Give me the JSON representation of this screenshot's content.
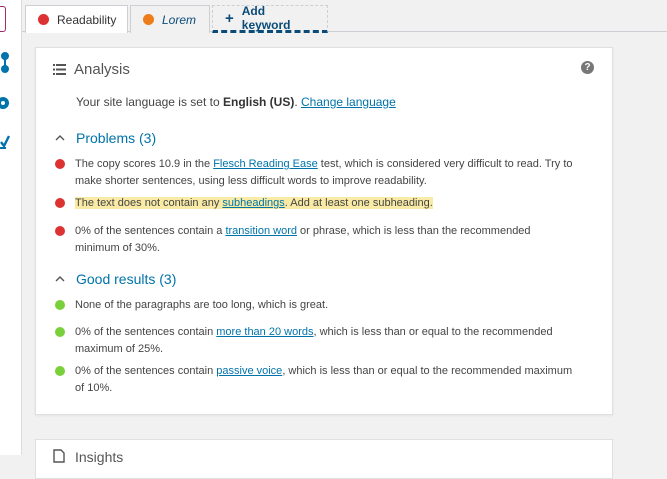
{
  "colors": {
    "bad": "#dc3232",
    "good": "#7ad03a",
    "ok": "#ee7c1b",
    "link": "#0073aa",
    "highlight": "#f9eba5"
  },
  "tabs": [
    {
      "label": "Readability",
      "status": "bad"
    },
    {
      "label": "Lorem",
      "status": "ok"
    },
    {
      "label": "Add keyword",
      "icon": "plus-icon"
    }
  ],
  "analysis": {
    "title": "Analysis",
    "language_prefix": "Your site language is set to ",
    "language": "English (US)",
    "language_suffix": ". ",
    "change_language": "Change language",
    "problems_title": "Problems (3)",
    "problems": [
      {
        "pre": "The copy scores 10.9 in the ",
        "link": "Flesch Reading Ease",
        "post": " test, which is considered very difficult to read. Try to make shorter sentences, using less difficult words to improve readability."
      },
      {
        "pre": "The text does not contain any ",
        "link": "subheadings",
        "post": ". Add at least one subheading."
      },
      {
        "pre": "0% of the sentences contain a ",
        "link": "transition word",
        "post": " or phrase, which is less than the recommended minimum of 30%."
      }
    ],
    "good_title": "Good results (3)",
    "good": [
      {
        "pre": "None of the paragraphs are too long, which is great.",
        "link": "",
        "post": ""
      },
      {
        "pre": "0% of the sentences contain ",
        "link": "more than 20 words",
        "post": ", which is less than or equal to the recommended maximum of 25%."
      },
      {
        "pre": "0% of the sentences contain ",
        "link": "passive voice",
        "post": ", which is less than or equal to the recommended maximum of 10%."
      }
    ]
  },
  "insights": {
    "title": "Insights"
  }
}
